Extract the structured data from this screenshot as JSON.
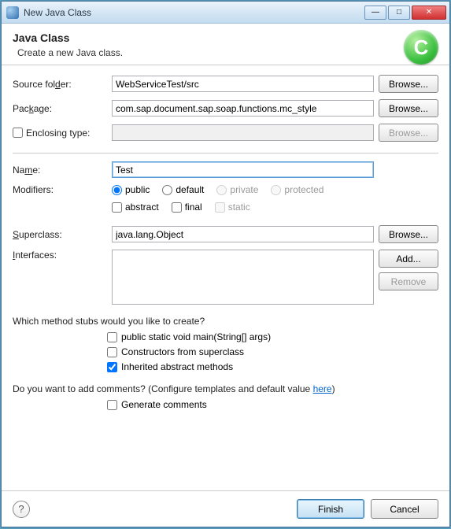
{
  "window": {
    "title": "New Java Class"
  },
  "header": {
    "title": "Java Class",
    "subtitle": "Create a new Java class.",
    "icon_letter": "C"
  },
  "fields": {
    "source_folder": {
      "label": "Source folder:",
      "value": "WebServiceTest/src",
      "browse": "Browse..."
    },
    "package": {
      "label": "Package:",
      "value": "com.sap.document.sap.soap.functions.mc_style",
      "browse": "Browse..."
    },
    "enclosing": {
      "label": "Enclosing type:",
      "value": "",
      "browse": "Browse..."
    },
    "name": {
      "label": "Name:",
      "value": "Test"
    },
    "modifiers": {
      "label": "Modifiers:",
      "radios": {
        "public": "public",
        "default": "default",
        "private": "private",
        "protected": "protected"
      },
      "checks": {
        "abstract": "abstract",
        "final": "final",
        "static": "static"
      }
    },
    "superclass": {
      "label": "Superclass:",
      "value": "java.lang.Object",
      "browse": "Browse..."
    },
    "interfaces": {
      "label": "Interfaces:",
      "add": "Add...",
      "remove": "Remove"
    }
  },
  "stubs": {
    "question": "Which method stubs would you like to create?",
    "main": "public static void main(String[] args)",
    "constructors": "Constructors from superclass",
    "inherited": "Inherited abstract methods"
  },
  "comments": {
    "question_pre": "Do you want to add comments? (Configure templates and default value ",
    "link": "here",
    "question_post": ")",
    "generate": "Generate comments"
  },
  "footer": {
    "finish": "Finish",
    "cancel": "Cancel",
    "help": "?"
  }
}
